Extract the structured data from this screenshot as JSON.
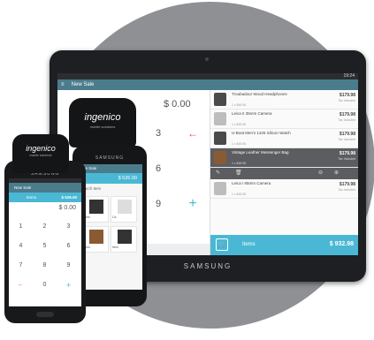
{
  "tablet": {
    "status_time": "19:24",
    "app_title": "New Sale",
    "amount": "$ 0.00",
    "keys": [
      "3",
      "6",
      "9"
    ],
    "back_key": "←",
    "plus_key": "+",
    "brand": "SAMSUNG",
    "items": [
      {
        "name": "Troubadour Wood Headphones",
        "sub": "1 x $49.50",
        "price": "$179.98",
        "tax": "Tax Included"
      },
      {
        "name": "Leica II 35mm Camera",
        "sub": "1 x $49.50",
        "price": "$179.98",
        "tax": "Tax Included"
      },
      {
        "name": "U-Boat Men's 1425 Silicon Watch",
        "sub": "1 x $49.50",
        "price": "$179.98",
        "tax": "Tax Included"
      },
      {
        "name": "Vintage Leather Messenger Bag",
        "sub": "1 x $49.50",
        "price": "$179.98",
        "tax": "Tax Included"
      },
      {
        "name": "Leica I 65mm Camera",
        "sub": "1 x $49.50",
        "price": "$179.98",
        "tax": "Tax Included"
      }
    ],
    "checkout_label": "Items",
    "checkout_total": "$ 932.98"
  },
  "reader": {
    "brand": "ingenico",
    "sub": "mobile solutions"
  },
  "phone_mid": {
    "brand": "SAMSUNG",
    "title": "New Sale",
    "amount": "$ 526.00",
    "search": "Search Item",
    "tiles": [
      "Item",
      "Ca",
      "Item",
      "Item"
    ]
  },
  "phone_front": {
    "brand": "SAMSUNG",
    "title": "New Sale",
    "sub_label": "Items",
    "sub_amount": "$ 526.00",
    "amount": "$ 0.00",
    "keys": [
      "1",
      "2",
      "3",
      "4",
      "5",
      "6",
      "7",
      "8",
      "9",
      "←",
      "0",
      "+"
    ]
  }
}
